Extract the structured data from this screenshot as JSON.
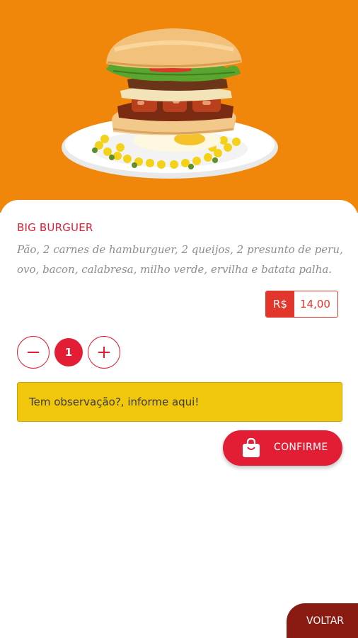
{
  "product": {
    "name": "BIG BURGUER",
    "description": "Pão, 2 carnes de hamburguer, 2 queijos, 2 presunto de peru, ovo, bacon, calabresa, milho verde, ervilha e batata palha.",
    "image_icon": "burger-photo"
  },
  "price": {
    "currency": "R$",
    "value": "14,00"
  },
  "quantity": {
    "value": "1",
    "minus_icon": "minus-icon",
    "plus_icon": "plus-icon"
  },
  "observation": {
    "placeholder": "Tem observação?, informe aqui!"
  },
  "actions": {
    "confirm_label": "CONFIRME",
    "confirm_icon": "shopping-bag-icon",
    "back_label": "VOLTAR"
  },
  "colors": {
    "hero_bg": "#f0870a",
    "accent_red": "#e21d34",
    "price_red": "#e2352b",
    "observation_bg": "#f0c70a",
    "back_bg": "#8a1b12"
  }
}
